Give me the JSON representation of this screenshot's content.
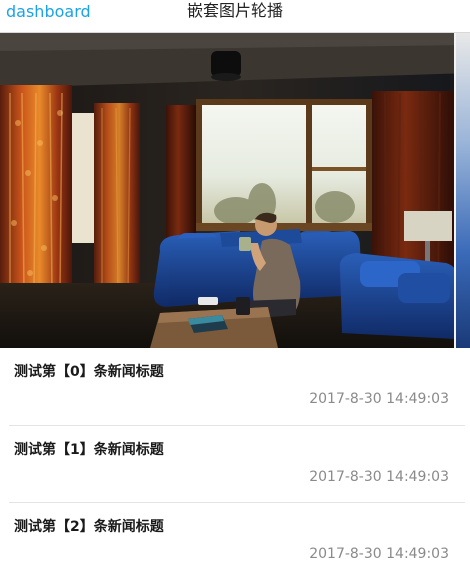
{
  "header": {
    "back_label": "dashboard",
    "title": "嵌套图片轮播"
  },
  "carousel": {
    "accent_color": "#1aa3e8"
  },
  "news": [
    {
      "title": "测试第【0】条新闻标题",
      "time": "2017-8-30 14:49:03"
    },
    {
      "title": "测试第【1】条新闻标题",
      "time": "2017-8-30 14:49:03"
    },
    {
      "title": "测试第【2】条新闻标题",
      "time": "2017-8-30 14:49:03"
    }
  ]
}
